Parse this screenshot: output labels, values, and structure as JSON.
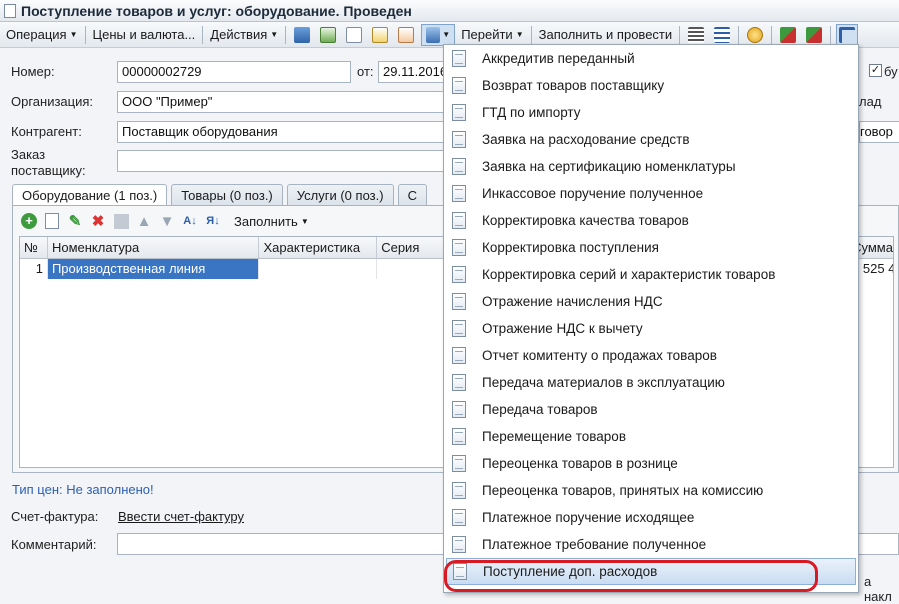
{
  "window": {
    "title": "Поступление товаров и услуг: оборудование. Проведен"
  },
  "toolbar": {
    "operation": "Операция",
    "prices_currency": "Цены и валюта...",
    "actions": "Действия",
    "goto": "Перейти",
    "fill_and_post": "Заполнить и провести"
  },
  "form": {
    "number_label": "Номер:",
    "number_value": "00000002729",
    "date_label": "от:",
    "date_value": "29.11.2016",
    "org_label": "Организация:",
    "org_value": "ООО \"Пример\"",
    "contractor_label": "Контрагент:",
    "contractor_value": "Поставщик оборудования",
    "order_label_1": "Заказ",
    "order_label_2": "поставщику:",
    "right_partial_1": "бу",
    "right_partial_2": "лад",
    "right_partial_3": "говор",
    "price_type": "Тип цен: Не заполнено!",
    "invoice_label": "Счет-фактура:",
    "invoice_link": "Ввести счет-фактуру",
    "comment_label": "Комментарий:",
    "bottom_right_partial": "а накл"
  },
  "tabs": [
    {
      "label": "Оборудование (1 поз.)"
    },
    {
      "label": "Товары (0 поз.)"
    },
    {
      "label": "Услуги (0 поз.)"
    },
    {
      "label": "С"
    }
  ],
  "panel": {
    "fill_label": "Заполнить"
  },
  "grid": {
    "columns": [
      "№",
      "Номенклатура",
      "Характеристика",
      "Серия",
      "Сумма"
    ],
    "rows": [
      {
        "num": "1",
        "item": "Производственная линия",
        "sum_partial": "1 525 42"
      }
    ]
  },
  "menu": {
    "items": [
      "Аккредитив переданный",
      "Возврат товаров поставщику",
      "ГТД по импорту",
      "Заявка на расходование средств",
      "Заявка на сертификацию номенклатуры",
      "Инкассовое поручение полученное",
      "Корректировка качества товаров",
      "Корректировка поступления",
      "Корректировка серий и характеристик товаров",
      "Отражение начисления НДС",
      "Отражение НДС к вычету",
      "Отчет комитенту о продажах товаров",
      "Передача материалов в эксплуатацию",
      "Передача товаров",
      "Перемещение товаров",
      "Переоценка товаров в рознице",
      "Переоценка товаров, принятых на комиссию",
      "Платежное поручение исходящее",
      "Платежное требование полученное",
      "Поступление доп. расходов"
    ],
    "highlighted": "Поступление доп. расходов"
  },
  "colors": {
    "highlight_ring": "#d81a22",
    "selection": "#3a75c4",
    "link": "#2b5fb3"
  }
}
